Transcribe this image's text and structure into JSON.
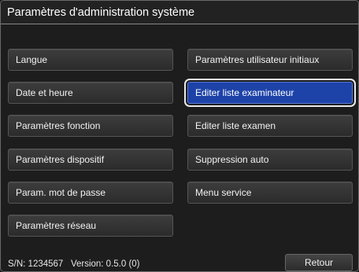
{
  "window": {
    "title": "Paramètres d'administration système"
  },
  "left_buttons": [
    {
      "label": "Langue"
    },
    {
      "label": "Date et heure"
    },
    {
      "label": "Paramètres fonction"
    },
    {
      "label": "Paramètres dispositif"
    },
    {
      "label": "Param. mot de passe"
    },
    {
      "label": "Paramètres réseau"
    }
  ],
  "right_buttons": [
    {
      "label": "Paramètres utilisateur initiaux"
    },
    {
      "label": "Editer liste examinateur",
      "selected": true
    },
    {
      "label": "Editer liste examen"
    },
    {
      "label": "Suppression auto"
    },
    {
      "label": "Menu service"
    }
  ],
  "footer": {
    "serial": "S/N: 1234567",
    "version": "Version: 0.5.0 (0)",
    "back_label": "Retour"
  },
  "colors": {
    "selected": "#1e43a8",
    "background": "#1d1d1d"
  }
}
